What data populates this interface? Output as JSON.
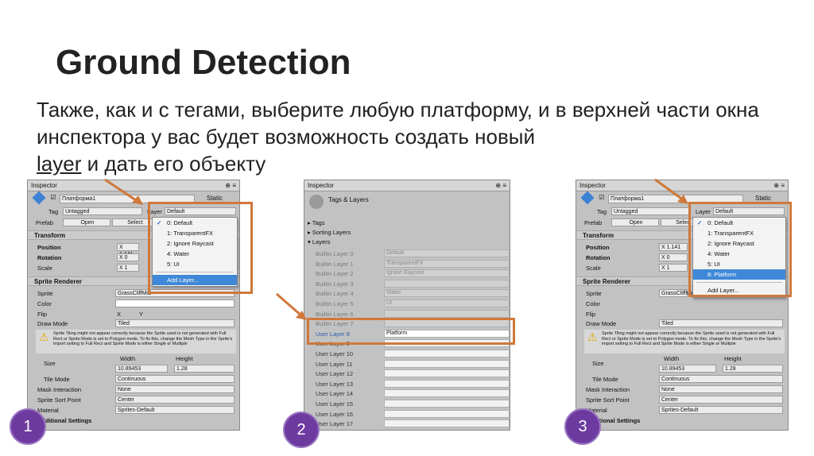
{
  "slide": {
    "title": "Ground Detection",
    "body_part1": "Также, как и с тегами, выберите любую платформу, и в верхней части окна инспектора у вас будет возможность создать новый",
    "body_link": "layer",
    "body_part2": "и дать его объекту"
  },
  "panel1": {
    "tab": "Inspector",
    "object_name": "Платформа1",
    "static": "Static",
    "tag_label": "Tag",
    "tag_value": "Untagged",
    "layer_label": "Layer",
    "layer_value": "Default",
    "prefab": "Prefab",
    "open": "Open",
    "select": "Select",
    "transform": "Transform",
    "position": "Position",
    "rotation": "Rotation",
    "scale": "Scale",
    "x_pos": "X 1.141",
    "x_rot": "X 0",
    "x_scale": "X 1",
    "sprite_renderer": "Sprite Renderer",
    "sprite": "Sprite",
    "sprite_value": "GrassCliffMid",
    "color": "Color",
    "flip": "Flip",
    "flip_x": "X",
    "flip_y": "Y",
    "draw_mode": "Draw Mode",
    "draw_mode_value": "Tiled",
    "warning": "Sprite Tiling might not appear correctly because the Sprite used is not generated with Full Rect or Sprite Mode is set to Polygon mode. To fix this, change the Mesh Type in the Sprite's import setting to Full Rect and Sprite Mode is either Single or Multiple",
    "size": "Size",
    "width_label": "Width",
    "height_label": "Height",
    "width": "10.89453",
    "height": "1.28",
    "tile_mode": "Tile Mode",
    "tile_mode_value": "Continuous",
    "mask_interaction": "Mask Interaction",
    "mask_value": "None",
    "sprite_sort_point": "Sprite Sort Point",
    "sort_value": "Center",
    "material": "Material",
    "material_value": "Sprites-Default",
    "additional": "Additional Settings",
    "dropdown": [
      "0: Default",
      "1: TransparentFX",
      "2: Ignore Raycast",
      "4: Water",
      "5: UI"
    ],
    "add_layer": "Add Layer..."
  },
  "panel2": {
    "tab": "Inspector",
    "title": "Tags & Layers",
    "tags": "Tags",
    "sorting": "Sorting Layers",
    "layers": "Layers",
    "rows": [
      {
        "label": "Builtin Layer 0",
        "value": "Default"
      },
      {
        "label": "Builtin Layer 1",
        "value": "TransparentFX"
      },
      {
        "label": "Builtin Layer 2",
        "value": "Ignore Raycast"
      },
      {
        "label": "Builtin Layer 3",
        "value": ""
      },
      {
        "label": "Builtin Layer 4",
        "value": "Water"
      },
      {
        "label": "Builtin Layer 5",
        "value": "UI"
      },
      {
        "label": "Builtin Layer 6",
        "value": ""
      },
      {
        "label": "Builtin Layer 7",
        "value": ""
      },
      {
        "label": "User Layer 8",
        "value": "Platform"
      },
      {
        "label": "User Layer 9",
        "value": ""
      },
      {
        "label": "User Layer 10",
        "value": ""
      },
      {
        "label": "User Layer 11",
        "value": ""
      },
      {
        "label": "User Layer 12",
        "value": ""
      },
      {
        "label": "User Layer 13",
        "value": ""
      },
      {
        "label": "User Layer 14",
        "value": ""
      },
      {
        "label": "User Layer 15",
        "value": ""
      },
      {
        "label": "User Layer 16",
        "value": ""
      },
      {
        "label": "User Layer 17",
        "value": ""
      }
    ]
  },
  "panel3": {
    "dropdown": [
      "0: Default",
      "1: TransparentFX",
      "2: Ignore Raycast",
      "4: Water",
      "5: UI",
      "8: Platform"
    ],
    "add_layer": "Add Layer..."
  },
  "badges": [
    "1",
    "2",
    "3"
  ],
  "colors": {
    "highlight": "#d0783a",
    "badge": "#6d3ba0",
    "selection": "#3f88d8"
  }
}
